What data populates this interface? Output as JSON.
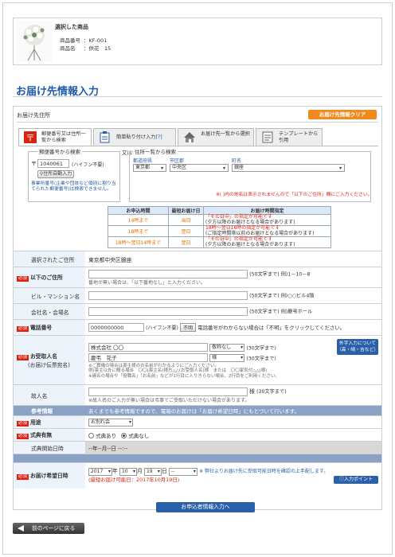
{
  "product": {
    "section_title": "選択した商品",
    "code_label": "商品番号",
    "code_value": "：KF-001",
    "name_label": "商品名",
    "name_value": "：供花　15"
  },
  "page_title": "お届け先情報入力",
  "form_section": {
    "title": "お届け先住所",
    "clear_button": "お届け先情報クリア"
  },
  "tabs": [
    {
      "label": "郵便番号又は住所一覧から検索"
    },
    {
      "label": "簡単貼り付け入力",
      "help": "[?]"
    },
    {
      "label": "お届け先一覧から選択"
    },
    {
      "label": "テンプレートから引用"
    }
  ],
  "zip_search": {
    "legend": "郵便番号から検索",
    "prefix": "〒",
    "value": "1040061",
    "hint": "(ハイフン不要)",
    "auto_button": "住所自動入力",
    "note": "事業所番号(企業や団体など個別に割り当てられた郵便番号)は検索できません。"
  },
  "or_label": "又は",
  "addr_search": {
    "legend": "住所一覧から検索",
    "pref_label": "都道府県",
    "pref_value": "東京都",
    "city_label": "市区郡",
    "city_value": "中央区",
    "town_label": "町名",
    "town_value": "銀座",
    "note": "※( )内の地名は表示されませんので「以下のご住所」欄にご入力ください。"
  },
  "time_table": {
    "headers": [
      "お申込時間",
      "最短お届け日",
      "お届け時間指定"
    ],
    "rows": [
      {
        "time": "14時まで",
        "day": "当日",
        "spec_red": "「その日中」の指定が可能です",
        "spec": "(夕方以降のお届けとなる場合があります)"
      },
      {
        "time": "18時まで",
        "day": "翌日",
        "spec_red": "18時～翌日18時の指定が可能です",
        "spec": "(ご指定時間帯以前のお届けとなる場合があります)"
      },
      {
        "time": "18時～翌日14時まで",
        "day": "翌日",
        "spec_red": "「その日中」の指定が可能です",
        "spec": "(夕方以降のお届けとなる場合があります)"
      }
    ]
  },
  "fields": {
    "selected_addr_label": "選択されたご住所",
    "selected_addr_value": "東京都中央区銀座",
    "required": "必須",
    "address_label": "以下のご住所",
    "address_limit": "(50文字まで) 例)1－10－8",
    "address_note": "番地が無い場合は、「以下番地なし」と入力ください。",
    "building_label": "ビル・マンション名",
    "building_limit": "(50文字まで) 例)○○ビル4階",
    "company_label": "会社名・会場名",
    "company_limit": "(50文字まで) 例)慶弔ホール",
    "phone_label": "電話番号",
    "phone_value": "0000000000",
    "phone_hint": "(ハイフン不要)",
    "unknown_button": "不明",
    "phone_note": "電話番号がわからない場合は「不明」をクリックしてください。",
    "recipient_label": "お受取人名",
    "recipient_sub": "(お届け伝票宛名)",
    "recipient1_value": "株式会社 〇〇",
    "recipient1_honor": "敬称なし",
    "recipient2_value": "慶弔　花子",
    "recipient2_honor": "様",
    "recipient_limit": "(30文字まで)",
    "foreign_button": "外字入力について（高・崎・吉など）",
    "recipient_note1": "※ご葬儀の場合は喪主様のお名前がわかるようにご入力ください。",
    "recipient_note2": "例)喪主以外に贈る場合　〇〇(喪主名)様方△△(お受取人名)様　または　〇〇家気付△△(様)",
    "recipient_note3": "※連名の場合や「役職名」「お名前」などが1行目に入りきらない場合、2行目をご利用ください。",
    "deceased_label": "故人名",
    "deceased_suffix": "様",
    "deceased_limit": "(30文字まで)",
    "deceased_note": "※故人名のご入力が無い場合は弔事でご受取いただけない場合があります。",
    "ref_label": "参考情報",
    "ref_note": "あくまでも参考情報ですので、電報のお届けは「お届け希望日時」にもとづいて行います。",
    "usage_label": "用途",
    "usage_value": "お別れ会",
    "ceremony_label": "式典有無",
    "ceremony_opt1": "式典あり",
    "ceremony_opt2": "式典なし",
    "ceremony_start_label": "式典開始日時",
    "ceremony_start_value": "--年--月--日 --:--",
    "delivery_label": "お届け希望日時",
    "year": "2017",
    "year_unit": "年",
    "month": "10",
    "month_unit": "月",
    "day": "19",
    "day_unit": "日",
    "hour": "--",
    "earliest": "(最短お届け可能日：2017年10月19日)",
    "delivery_note": "※ 弊社よりお届け先に受取可能日時を確認の上手配します。",
    "input_point": "入力ポイント"
  },
  "submit_button": "お申込者情報入力へ",
  "back_button": "前のページに戻る"
}
